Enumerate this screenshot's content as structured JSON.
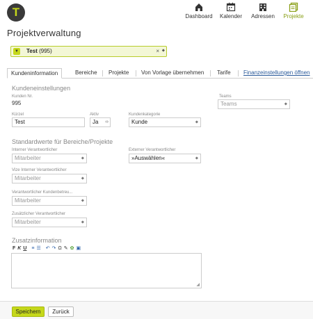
{
  "app": {
    "logo_letter": "T"
  },
  "nav": [
    {
      "label": "Dashboard",
      "icon": "home-icon"
    },
    {
      "label": "Kalender",
      "icon": "calendar-icon"
    },
    {
      "label": "Adressen",
      "icon": "building-icon"
    },
    {
      "label": "Projekte",
      "icon": "projects-icon"
    }
  ],
  "colors": {
    "accent": "#c5d81a",
    "active_nav": "#8aa018",
    "link": "#2a5a9a"
  },
  "page_title": "Projektverwaltung",
  "project_select": {
    "name": "Test",
    "number": "(995)",
    "clear": "×"
  },
  "tabs": [
    {
      "label": "Kundeninformation"
    },
    {
      "label": "Bereiche"
    },
    {
      "label": "Projekte"
    },
    {
      "label": "Von Vorlage übernehmen"
    },
    {
      "label": "Tarife"
    },
    {
      "label": "Finanzeinstellungen öffnen"
    }
  ],
  "customer_settings": {
    "heading": "Kundeneinstellungen",
    "kunden_nr_label": "Kunden Nr.",
    "kunden_nr_value": "995",
    "teams_label": "Teams",
    "teams_value": "Teams",
    "kurztel_label": "Kürzel",
    "kurztel_value": "Test",
    "aktiv_label": "Aktiv",
    "aktiv_value": "Ja",
    "kategorie_label": "Kundenkategorie",
    "kategorie_value": "Kunde"
  },
  "defaults": {
    "heading": "Standardwerte für Bereiche/Projekte",
    "internal_label": "Interner Verantwortlicher",
    "internal_value": "Mitarbeiter",
    "external_label": "Externer Verantwortlicher",
    "external_value": "»Auswählen«",
    "vice_label": "Vize Interner Verantwortlicher",
    "vice_value": "Mitarbeiter",
    "customer_rep_label": "Verantwortlicher Kundenbetreu...",
    "customer_rep_value": "Mitarbeiter",
    "additional_label": "Zusätzlicher Verantwortlicher",
    "additional_value": "Mitarbeiter"
  },
  "additional_info": {
    "heading": "Zusatzinformation",
    "toolbar": [
      "F",
      "K",
      "U",
      "≡",
      "☰",
      "↶",
      "↷",
      "Ω",
      "✎",
      "✿",
      "▣"
    ]
  },
  "footer": {
    "save": "Speichern",
    "back": "Zurück"
  }
}
